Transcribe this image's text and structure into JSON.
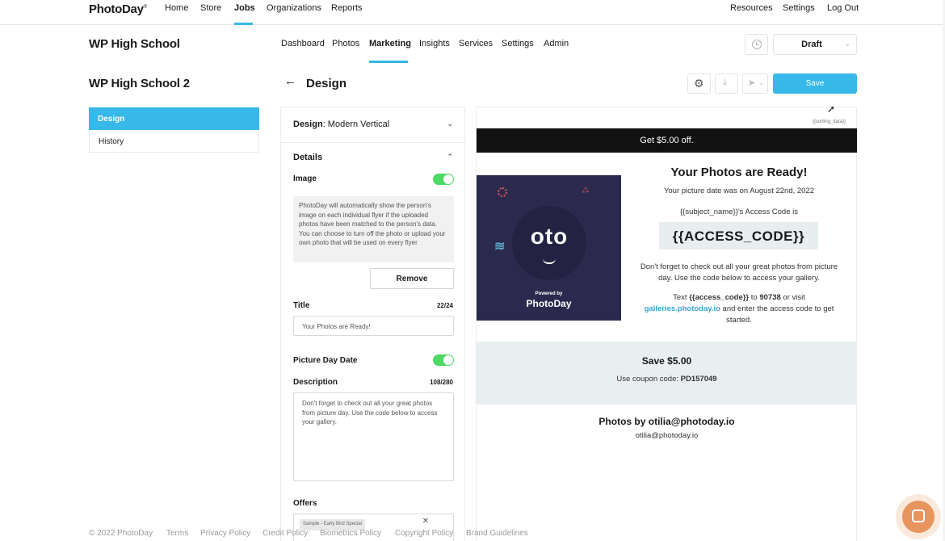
{
  "topnav": {
    "logo": "PhotoDay",
    "left_links": [
      "Home",
      "Store",
      "Jobs",
      "Organizations",
      "Reports"
    ],
    "right_links": [
      "Resources",
      "Settings",
      "Log Out"
    ]
  },
  "job": {
    "title": "WP High School",
    "tabs": [
      "Dashboard",
      "Photos",
      "Marketing",
      "Insights",
      "Services",
      "Settings",
      "Admin"
    ],
    "status": "Draft"
  },
  "sidebar": {
    "title": "WP High School 2",
    "items": [
      "Design",
      "History"
    ]
  },
  "page": {
    "title": "Design",
    "save_label": "Save"
  },
  "editor": {
    "design_label": "Design",
    "design_value": ": Modern Vertical",
    "details_label": "Details",
    "image_label": "Image",
    "image_info": "PhotoDay will automatically show the person's image on each individual flyer if the uploaded photos have been matched to the person's data. You can choose to turn off the photo or upload your own photo that will be used on every flyer",
    "remove_label": "Remove",
    "title_label": "Title",
    "title_count": "22/24",
    "title_value": "Your Photos are Ready!",
    "date_label": "Picture Day Date",
    "description_label": "Description",
    "description_count": "108/280",
    "description_value": "Don't forget to check out all your great photos from picture day. Use the code below to access your gallery.",
    "offers_label": "Offers",
    "offer_chip": "Sample - Early Bird Special"
  },
  "preview": {
    "sorting": "{{sorting_data}}",
    "banner": "Get $5.00 off.",
    "heading": "Your Photos are Ready!",
    "date_line": "Your picture date was on August 22nd, 2022",
    "code_intro": "{{subject_name}}'s Access Code is",
    "code": "{{ACCESS_CODE}}",
    "body": "Don't forget to check out all your great photos from picture day. Use the code below to access your gallery.",
    "text_prefix": "Text ",
    "text_code": "{{access_code}}",
    "text_to": " to ",
    "text_number": "90738",
    "text_or": " or visit",
    "gallery_link": "galleries.photoday.io",
    "text_after": " and enter the access code to get started.",
    "image": {
      "brand": "oto",
      "powered": "Powered by",
      "brand_logo": "PhotoDay"
    },
    "coupon_title": "Save $5.00",
    "coupon_prefix": "Use coupon code: ",
    "coupon_code": "PD157049",
    "photos_by": "Photos by otilia@photoday.io",
    "email": "otilia@photoday.io"
  },
  "footer": {
    "links": [
      "© 2022 PhotoDay",
      "Terms",
      "Privacy Policy",
      "Credit Policy",
      "Biometrics Policy",
      "Copyright Policy",
      "Brand Guidelines"
    ]
  },
  "colors": {
    "accent": "#36b8e8",
    "toggle_on": "#4cd964",
    "chat": "#e8945e"
  }
}
